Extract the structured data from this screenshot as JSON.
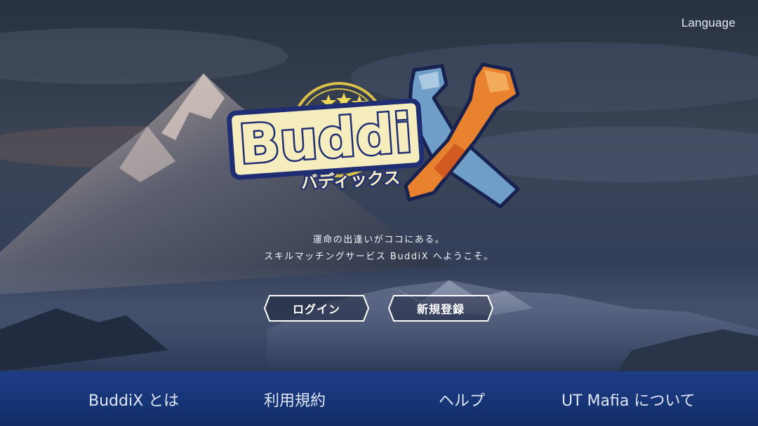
{
  "header": {
    "language_label": "Language"
  },
  "logo": {
    "brand_text": "Buddi",
    "brand_kana": "バディックス",
    "brand_x": "X"
  },
  "tagline": {
    "line1": "運命の出逢いがココにある。",
    "line2": "スキルマッチングサービス BuddiX へようこそ。"
  },
  "buttons": {
    "login": "ログイン",
    "register": "新規登録"
  },
  "footer": {
    "items": [
      {
        "label": "BuddiX とは"
      },
      {
        "label": "利用規約"
      },
      {
        "label": "ヘルプ"
      },
      {
        "label": "UT Mafia について"
      }
    ]
  },
  "colors": {
    "footer_bg": "#173576",
    "logo_yellow": "#f3e7a8",
    "logo_navy": "#2a3d8c"
  }
}
